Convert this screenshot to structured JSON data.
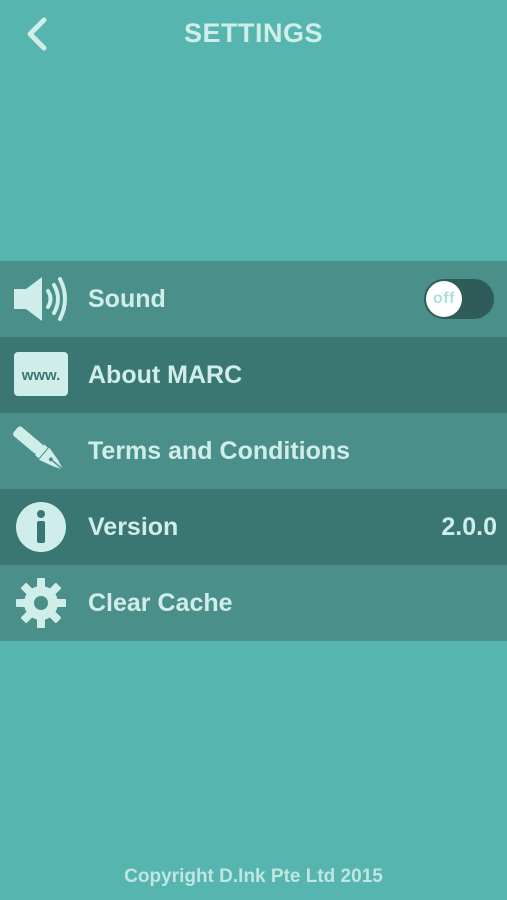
{
  "header": {
    "title": "SETTINGS",
    "back_icon": "chevron-left-icon"
  },
  "menu": {
    "items": [
      {
        "label": "Sound",
        "icon": "speaker-icon",
        "control": "toggle"
      },
      {
        "label": "About MARC",
        "icon": "www-icon"
      },
      {
        "label": "Terms and Conditions",
        "icon": "fountain-pen-icon"
      },
      {
        "label": "Version",
        "icon": "info-icon",
        "value": "2.0.0"
      },
      {
        "label": "Clear Cache",
        "icon": "gear-icon"
      }
    ]
  },
  "sound_toggle": {
    "state_label": "off",
    "is_on": false
  },
  "www_icon_text": "www.",
  "footer": {
    "copyright": "Copyright D.Ink Pte Ltd 2015"
  },
  "colors": {
    "background": "#57b5b0",
    "row_light": "#4b8f8a",
    "row_dark": "#3a7672",
    "text": "#cfeeea",
    "toggle_track": "#2f5b59",
    "toggle_knob": "#ffffff"
  }
}
